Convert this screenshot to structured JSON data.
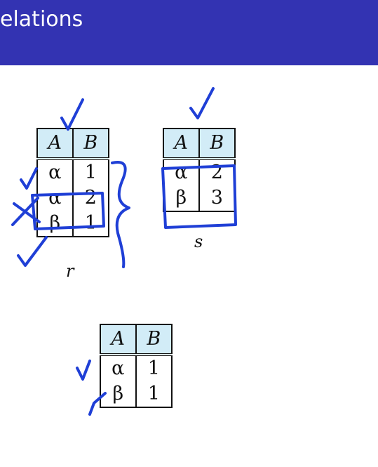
{
  "header": {
    "title": "elations"
  },
  "colors": {
    "header_bg": "#3333b2",
    "cell_header_bg": "#d2ecf7",
    "ink": "#1f3fd6"
  },
  "relation_r": {
    "caption": "r",
    "columns": [
      "A",
      "B"
    ],
    "rows": [
      [
        "α",
        "1"
      ],
      [
        "α",
        "2"
      ],
      [
        "β",
        "1"
      ]
    ]
  },
  "relation_s": {
    "caption": "s",
    "columns": [
      "A",
      "B"
    ],
    "rows": [
      [
        "α",
        "2"
      ],
      [
        "β",
        "3"
      ]
    ]
  },
  "result": {
    "columns": [
      "A",
      "B"
    ],
    "rows": [
      [
        "α",
        "1"
      ],
      [
        "β",
        "1"
      ]
    ]
  }
}
